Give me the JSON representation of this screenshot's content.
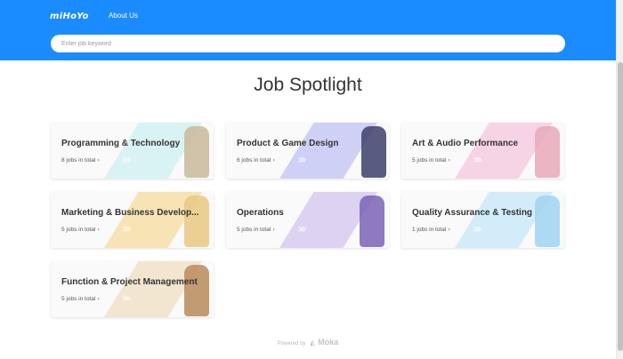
{
  "header": {
    "logo": "miHoYo",
    "about_label": "About Us",
    "search_placeholder": "Enter job keyword"
  },
  "page_title": "Job Spotlight",
  "cards": [
    {
      "title": "Programming & Technology",
      "count": "8 jobs in total",
      "stripe": "#d9f3f5",
      "figure": "#c9b89a"
    },
    {
      "title": "Product & Game Design",
      "count": "6 jobs in total",
      "stripe": "#cfd0f5",
      "figure": "#3c3f6b"
    },
    {
      "title": "Art & Audio Performance",
      "count": "5 jobs in total",
      "stripe": "#f7d3e6",
      "figure": "#e8a8b8"
    },
    {
      "title": "Marketing & Business Develop...",
      "count": "5 jobs in total",
      "stripe": "#f8e3b5",
      "figure": "#e9c880"
    },
    {
      "title": "Operations",
      "count": "5 jobs in total",
      "stripe": "#ded2f3",
      "figure": "#7a63b5"
    },
    {
      "title": "Quality Assurance & Testing",
      "count": "1 jobs in total",
      "stripe": "#d3ecfa",
      "figure": "#9fd3f0"
    },
    {
      "title": "Function & Project Management",
      "count": "5 jobs in total",
      "stripe": "#f3e6d0",
      "figure": "#b8895a"
    }
  ],
  "footer": {
    "powered_by": "Powered by",
    "brand": "Moka"
  }
}
